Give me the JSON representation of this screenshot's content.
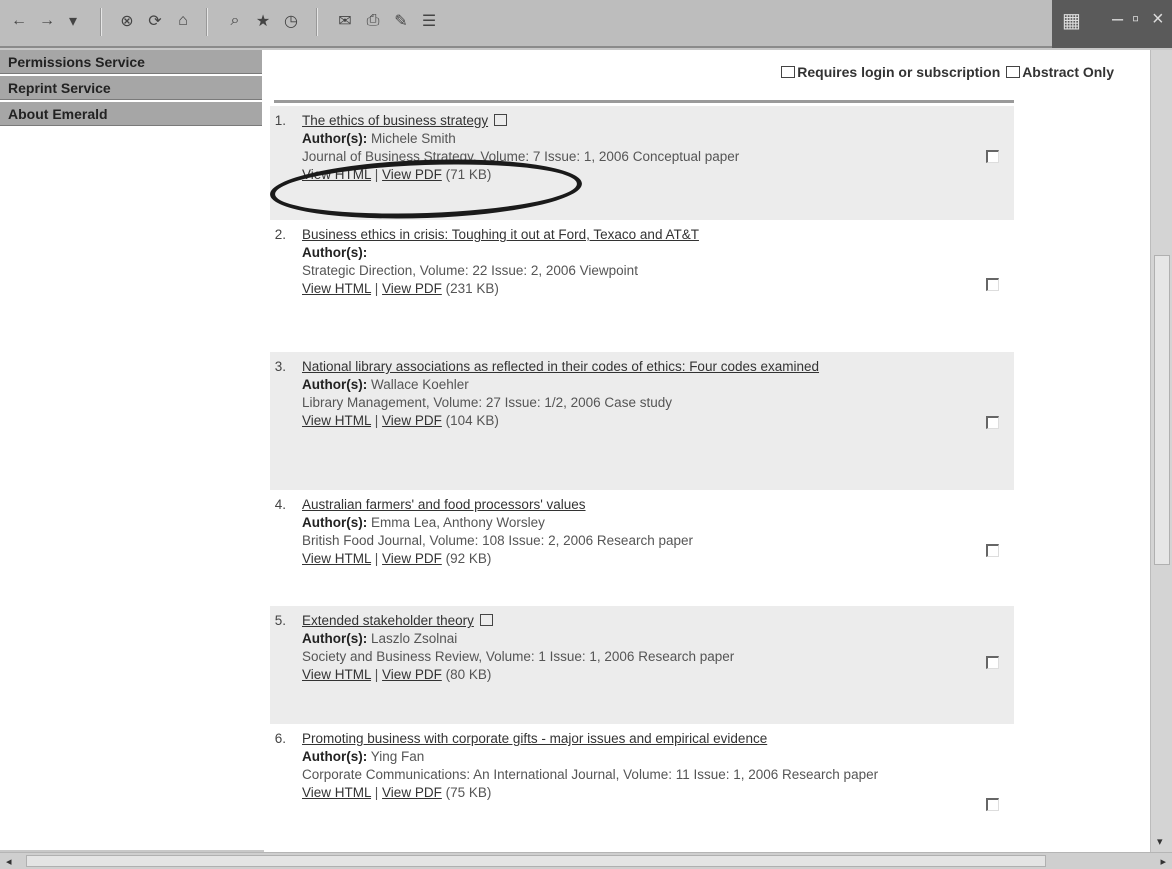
{
  "sidebar": {
    "items": [
      {
        "label": "Permissions Service"
      },
      {
        "label": "Reprint Service"
      },
      {
        "label": "About Emerald"
      }
    ]
  },
  "legend": {
    "requires_login": "Requires login or subscription",
    "abstract_only": "Abstract Only"
  },
  "results": [
    {
      "num": "1.",
      "title": "The ethics of business strategy",
      "authors_label": "Author(s):",
      "authors": "Michele Smith",
      "source": "Journal of Business Strategy, Volume: 7 Issue: 1, 2006 Conceptual paper",
      "view_html": "View HTML",
      "view_pdf": "View PDF",
      "size": "(71 KB)"
    },
    {
      "num": "2.",
      "title": "Business ethics in crisis: Toughing it out at Ford, Texaco and AT&T",
      "authors_label": "Author(s):",
      "authors": "",
      "source": "Strategic Direction, Volume: 22 Issue: 2, 2006 Viewpoint",
      "view_html": "View HTML",
      "view_pdf": "View PDF",
      "size": "(231 KB)"
    },
    {
      "num": "3.",
      "title": "National library associations as reflected in their codes of ethics: Four codes examined",
      "authors_label": "Author(s):",
      "authors": "Wallace Koehler",
      "source": "Library Management, Volume: 27 Issue: 1/2, 2006 Case study",
      "view_html": "View HTML",
      "view_pdf": "View PDF",
      "size": "(104 KB)"
    },
    {
      "num": "4.",
      "title": "Australian farmers' and food processors' values",
      "authors_label": "Author(s):",
      "authors": "Emma Lea, Anthony Worsley",
      "source": "British Food Journal, Volume: 108 Issue: 2, 2006 Research paper",
      "view_html": "View HTML",
      "view_pdf": "View PDF",
      "size": "(92 KB)"
    },
    {
      "num": "5.",
      "title": "Extended stakeholder theory",
      "authors_label": "Author(s):",
      "authors": "Laszlo Zsolnai",
      "source": "Society and Business Review, Volume: 1 Issue: 1, 2006 Research paper",
      "view_html": "View HTML",
      "view_pdf": "View PDF",
      "size": "(80 KB)"
    },
    {
      "num": "6.",
      "title": "Promoting business with corporate gifts - major issues and empirical evidence",
      "authors_label": "Author(s):",
      "authors": "Ying Fan",
      "source": "Corporate Communications: An International Journal, Volume: 11 Issue: 1, 2006 Research paper",
      "view_html": "View HTML",
      "view_pdf": "View PDF",
      "size": "(75 KB)"
    }
  ]
}
